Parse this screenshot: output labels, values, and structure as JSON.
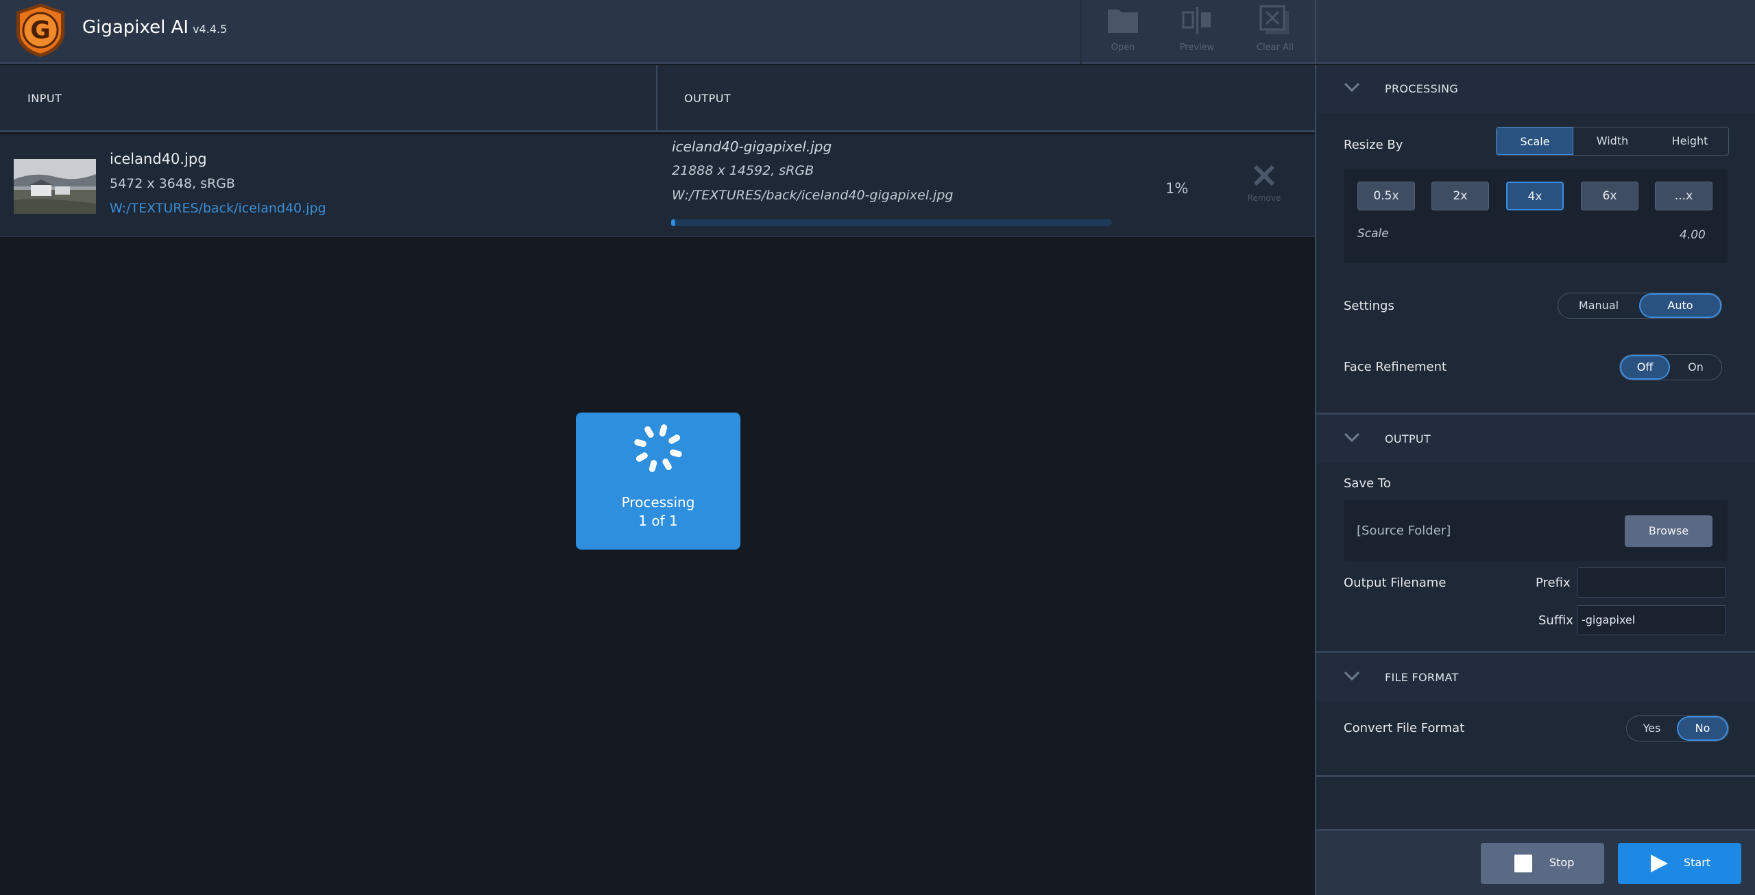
{
  "app": {
    "title": "Gigapixel AI",
    "version": "v4.4.5"
  },
  "toolbar": {
    "open_label": "Open",
    "preview_label": "Preview",
    "clear_label": "Clear All"
  },
  "columns": {
    "input": "INPUT",
    "output": "OUTPUT"
  },
  "file": {
    "input_name": "iceland40.jpg",
    "input_dims": "5472 x 3648, sRGB",
    "input_path": "W:/TEXTURES/back/iceland40.jpg",
    "output_name": "iceland40-gigapixel.jpg",
    "output_dims": "21888 x 14592, sRGB",
    "output_path": "W:/TEXTURES/back/iceland40-gigapixel.jpg",
    "progress_percent": 1,
    "progress_label": "1%",
    "remove_label": "Remove"
  },
  "processing_overlay": {
    "line1": "Processing",
    "line2": "1 of 1"
  },
  "panel": {
    "processing": {
      "title": "PROCESSING",
      "resize_by_label": "Resize By",
      "resize_options": [
        "Scale",
        "Width",
        "Height"
      ],
      "resize_selected": "Scale",
      "scale_buttons": [
        "0.5x",
        "2x",
        "4x",
        "6x",
        "...x"
      ],
      "scale_selected": "4x",
      "scale_label": "Scale",
      "scale_value": "4.00",
      "settings_label": "Settings",
      "settings_options": [
        "Manual",
        "Auto"
      ],
      "settings_selected": "Auto",
      "face_label": "Face Refinement",
      "face_options": [
        "Off",
        "On"
      ],
      "face_selected": "Off"
    },
    "output": {
      "title": "OUTPUT",
      "save_to_label": "Save To",
      "save_to_value": "[Source Folder]",
      "browse_label": "Browse",
      "filename_label": "Output Filename",
      "prefix_label": "Prefix",
      "prefix_value": "",
      "suffix_label": "Suffix",
      "suffix_value": "-gigapixel"
    },
    "file_format": {
      "title": "FILE FORMAT",
      "convert_label": "Convert File Format",
      "convert_options": [
        "Yes",
        "No"
      ],
      "convert_selected": "No"
    }
  },
  "actions": {
    "stop_label": "Stop",
    "start_label": "Start"
  },
  "colors": {
    "accent": "#2d8fde",
    "background": "#141922",
    "panel": "#1f2837",
    "header": "#2a3548",
    "link": "#3a8fd6",
    "logo_orange": "#e8731a"
  }
}
